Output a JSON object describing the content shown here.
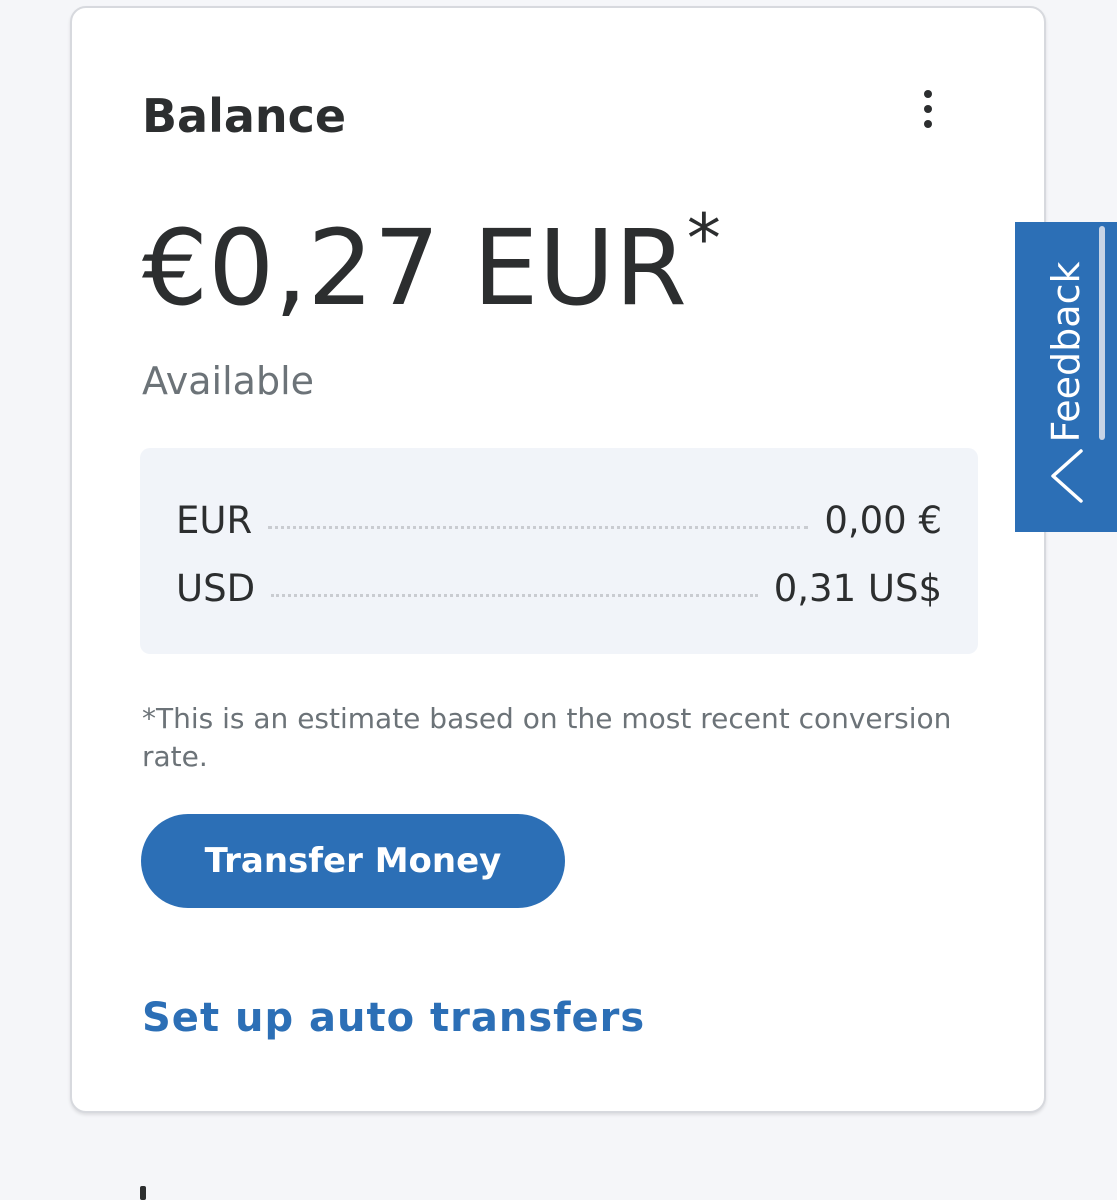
{
  "balance_card": {
    "title": "Balance",
    "amount": "€0,27 EUR",
    "amount_marker": "*",
    "available_label": "Available",
    "currencies": [
      {
        "code": "EUR",
        "value": "0,00 €"
      },
      {
        "code": "USD",
        "value": "0,31 US$"
      }
    ],
    "footnote": "*This is an estimate based on the most recent conversion rate.",
    "transfer_button_label": "Transfer Money",
    "auto_transfer_link": "Set up auto transfers",
    "more_menu_icon": "kebab-vertical-icon"
  },
  "feedback_tab": {
    "label": "Feedback",
    "icon": "chevron-left-icon"
  },
  "colors": {
    "brand_blue": "#2c6fb6",
    "page_background": "#f5f6f9",
    "card_background": "#ffffff",
    "currency_box_background": "#f1f4f9",
    "text_primary": "#2c2e2f",
    "text_secondary": "#6c7378"
  }
}
